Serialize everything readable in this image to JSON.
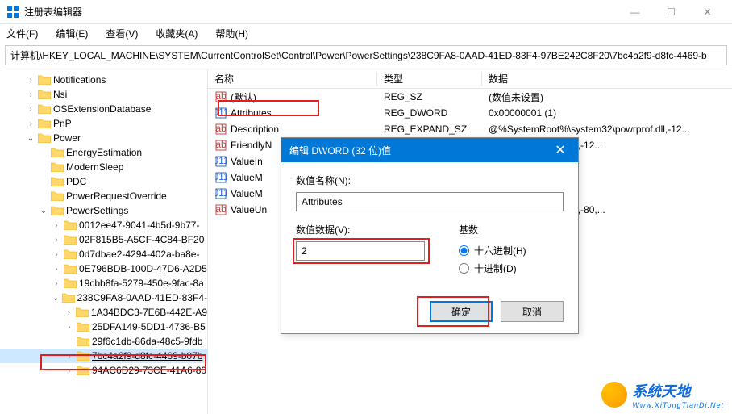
{
  "window": {
    "title": "注册表编辑器",
    "menus": [
      "文件(F)",
      "编辑(E)",
      "查看(V)",
      "收藏夹(A)",
      "帮助(H)"
    ],
    "address": "计算机\\HKEY_LOCAL_MACHINE\\SYSTEM\\CurrentControlSet\\Control\\Power\\PowerSettings\\238C9FA8-0AAD-41ED-83F4-97BE242C8F20\\7bc4a2f9-d8fc-4469-b"
  },
  "tree": [
    {
      "indent": 2,
      "twisty": ">",
      "label": "Notifications"
    },
    {
      "indent": 2,
      "twisty": ">",
      "label": "Nsi"
    },
    {
      "indent": 2,
      "twisty": ">",
      "label": "OSExtensionDatabase"
    },
    {
      "indent": 2,
      "twisty": ">",
      "label": "PnP"
    },
    {
      "indent": 2,
      "twisty": "v",
      "label": "Power"
    },
    {
      "indent": 3,
      "twisty": "",
      "label": "EnergyEstimation"
    },
    {
      "indent": 3,
      "twisty": "",
      "label": "ModernSleep"
    },
    {
      "indent": 3,
      "twisty": "",
      "label": "PDC"
    },
    {
      "indent": 3,
      "twisty": "",
      "label": "PowerRequestOverride"
    },
    {
      "indent": 3,
      "twisty": "v",
      "label": "PowerSettings"
    },
    {
      "indent": 4,
      "twisty": ">",
      "label": "0012ee47-9041-4b5d-9b77-"
    },
    {
      "indent": 4,
      "twisty": ">",
      "label": "02F815B5-A5CF-4C84-BF20"
    },
    {
      "indent": 4,
      "twisty": ">",
      "label": "0d7dbae2-4294-402a-ba8e-"
    },
    {
      "indent": 4,
      "twisty": ">",
      "label": "0E796BDB-100D-47D6-A2D5"
    },
    {
      "indent": 4,
      "twisty": ">",
      "label": "19cbb8fa-5279-450e-9fac-8a"
    },
    {
      "indent": 4,
      "twisty": "v",
      "label": "238C9FA8-0AAD-41ED-83F4-"
    },
    {
      "indent": 5,
      "twisty": ">",
      "label": "1A34BDC3-7E6B-442E-A9"
    },
    {
      "indent": 5,
      "twisty": ">",
      "label": "25DFA149-5DD1-4736-B5"
    },
    {
      "indent": 5,
      "twisty": "",
      "label": "29f6c1db-86da-48c5-9fdb"
    },
    {
      "indent": 5,
      "twisty": ">",
      "label": "7bc4a2f9-d8fc-4469-b07b",
      "selected": true
    },
    {
      "indent": 5,
      "twisty": ">",
      "label": "94AC6D29-73CE-41A6-80"
    }
  ],
  "list": {
    "headers": {
      "name": "名称",
      "type": "类型",
      "data": "数据"
    },
    "rows": [
      {
        "icon": "str",
        "name": "(默认)",
        "type": "REG_SZ",
        "data": "(数值未设置)"
      },
      {
        "icon": "dword",
        "name": "Attributes",
        "type": "REG_DWORD",
        "data": "0x00000001 (1)",
        "highlight": true
      },
      {
        "icon": "str",
        "name": "Description",
        "type": "REG_EXPAND_SZ",
        "data": "@%SystemRoot%\\system32\\powrprof.dll,-12..."
      },
      {
        "icon": "str",
        "name": "FriendlyN",
        "type": "",
        "data": "ystem32\\powrprof.dll,-12..."
      },
      {
        "icon": "dword",
        "name": "ValueIn",
        "type": "",
        "data": ""
      },
      {
        "icon": "dword",
        "name": "ValueM",
        "type": "",
        "data": ""
      },
      {
        "icon": "dword",
        "name": "ValueM",
        "type": "",
        "data": ""
      },
      {
        "icon": "str",
        "name": "ValueUn",
        "type": "",
        "data": "ystem32\\powrprof.dll,-80,..."
      }
    ]
  },
  "dialog": {
    "title": "编辑 DWORD (32 位)值",
    "name_label": "数值名称(N):",
    "name_value": "Attributes",
    "data_label": "数值数据(V):",
    "data_value": "2",
    "base_label": "基数",
    "radio_hex": "十六进制(H)",
    "radio_dec": "十进制(D)",
    "ok": "确定",
    "cancel": "取消"
  },
  "watermark": {
    "big": "系统天地",
    "small": "Www.XiTongTianDi.Net"
  }
}
